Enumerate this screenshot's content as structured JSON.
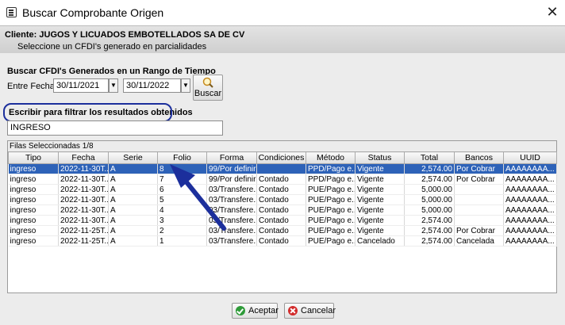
{
  "window": {
    "title": "Buscar Comprobante Origen",
    "close": "✕"
  },
  "client": {
    "title": "Cliente: JUGOS Y LICUADOS EMBOTELLADOS SA DE CV",
    "subtitle": "Seleccione un CFDI's generado en parcialidades"
  },
  "search": {
    "heading": "Buscar CFDI's Generados en un Rango de Tiempo",
    "range_label": "Entre Fechas",
    "date_from": "30/11/2021",
    "date_to": "30/11/2022",
    "button_label": "Buscar"
  },
  "filter": {
    "label": "Escribir para filtrar los resultados obtenidos",
    "value": "INGRESO"
  },
  "grid": {
    "caption": "Filas Seleccionadas  1/8",
    "columns": [
      "Tipo",
      "Fecha",
      "Serie",
      "Folio",
      "Forma",
      "Condiciones",
      "Método",
      "Status",
      "Total",
      "Bancos",
      "UUID"
    ],
    "rows": [
      [
        "ingreso",
        "2022-11-30T...",
        "A",
        "8",
        "99/Por definir",
        "",
        "PPD/Pago e...",
        "Vigente",
        "2,574.00",
        "Por Cobrar",
        "AAAAAAAA..."
      ],
      [
        "ingreso",
        "2022-11-30T...",
        "A",
        "7",
        "99/Por definir",
        "Contado",
        "PPD/Pago e...",
        "Vigente",
        "2,574.00",
        "Por Cobrar",
        "AAAAAAAA..."
      ],
      [
        "ingreso",
        "2022-11-30T...",
        "A",
        "6",
        "03/Transfere...",
        "Contado",
        "PUE/Pago e...",
        "Vigente",
        "5,000.00",
        "",
        "AAAAAAAA..."
      ],
      [
        "ingreso",
        "2022-11-30T...",
        "A",
        "5",
        "03/Transfere...",
        "Contado",
        "PUE/Pago e...",
        "Vigente",
        "5,000.00",
        "",
        "AAAAAAAA..."
      ],
      [
        "ingreso",
        "2022-11-30T...",
        "A",
        "4",
        "03/Transfere...",
        "Contado",
        "PUE/Pago e...",
        "Vigente",
        "5,000.00",
        "",
        "AAAAAAAA..."
      ],
      [
        "ingreso",
        "2022-11-30T...",
        "A",
        "3",
        "03/Transfere...",
        "Contado",
        "PUE/Pago e...",
        "Vigente",
        "2,574.00",
        "",
        "AAAAAAAA..."
      ],
      [
        "ingreso",
        "2022-11-25T...",
        "A",
        "2",
        "03/Transfere...",
        "Contado",
        "PUE/Pago e...",
        "Vigente",
        "2,574.00",
        "Por Cobrar",
        "AAAAAAAA..."
      ],
      [
        "ingreso",
        "2022-11-25T...",
        "A",
        "1",
        "03/Transfere...",
        "Contado",
        "PUE/Pago e...",
        "Cancelado",
        "2,574.00",
        "Cancelada",
        "AAAAAAAA..."
      ]
    ],
    "selected_row": 0
  },
  "buttons": {
    "accept": "Aceptar",
    "cancel": "Cancelar"
  },
  "colors": {
    "selection": "#2d62b8",
    "annotation": "#1c2f9c"
  }
}
